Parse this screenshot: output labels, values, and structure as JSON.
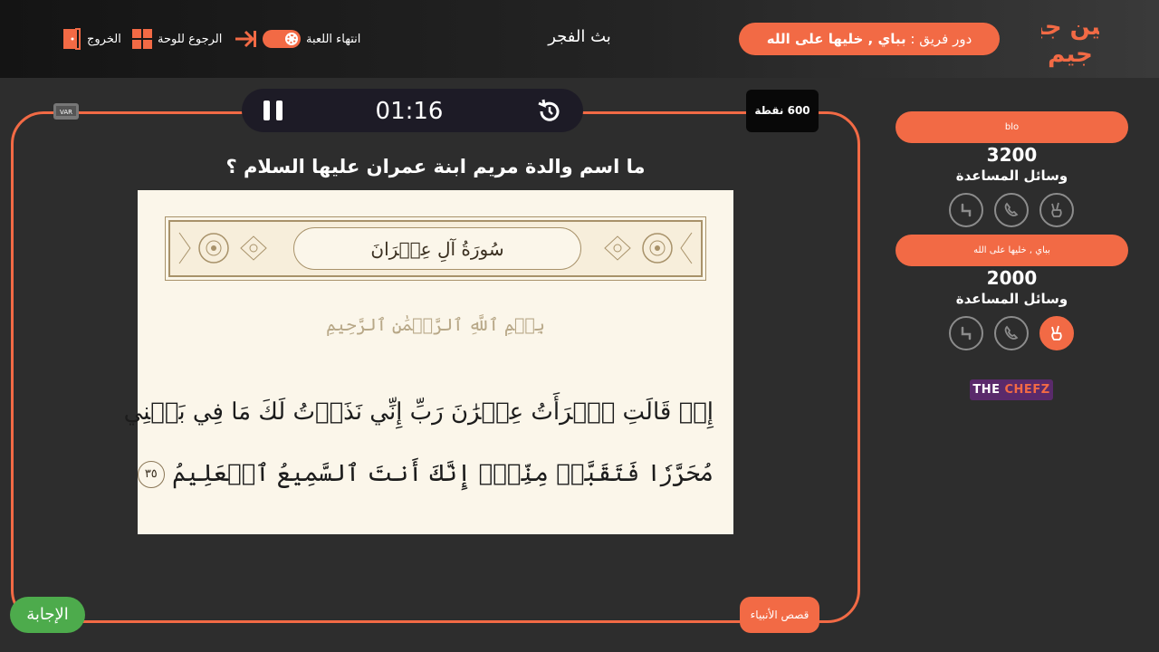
{
  "header": {
    "logo_text": "سين جيم",
    "turn_prefix": "دور فريق :",
    "turn_team": "بباي , خليها على الله",
    "game_title": "بث الفجر",
    "end_game_label": "انتهاء اللعبة",
    "back_to_board_label": "الرجوع للوحة",
    "exit_label": "الخروج"
  },
  "timer": {
    "time": "01:16"
  },
  "question": {
    "points": "600 نقطة",
    "text": "ما اسم والدة مريم ابنة عمران عليها السلام ؟",
    "image": {
      "surah_title": "سُورَةُ آلِ عِمۡرَانَ",
      "basmala": "بِسۡمِ ٱللَّهِ ٱلرَّحۡمَٰنِ ٱلرَّحِيمِ",
      "ayah_line_1": "إِذۡ قَالَتِ ٱمۡرَأَتُ عِمۡرَٰنَ رَبِّ إِنِّي نَذَرۡتُ لَكَ مَا فِي بَطۡنِي",
      "ayah_line_2": "مُحَرَّرٗا فَتَقَبَّلۡ مِنِّيٓۖ إِنَّكَ أَنتَ ٱلسَّمِيعُ ٱلۡعَلِيمُ",
      "ayah_number": "٣٥"
    }
  },
  "var_label": "VAR",
  "answer_label": "الإجابة",
  "category_label": "قصص الأنبياء",
  "teams": [
    {
      "name": "blo",
      "score": "3200",
      "help_label": "وسائل المساعدة",
      "active_lifeline": ""
    },
    {
      "name": "بباي , خليها على الله",
      "score": "2000",
      "help_label": "وسائل المساعدة",
      "active_lifeline": "peace"
    }
  ],
  "sponsor": {
    "part1": "THE ",
    "part2": "CHEFZ"
  },
  "colors": {
    "accent": "#f26a45",
    "answer": "#4dab4c",
    "background": "#2d2d2d",
    "timer_bg": "#1d1b26"
  }
}
